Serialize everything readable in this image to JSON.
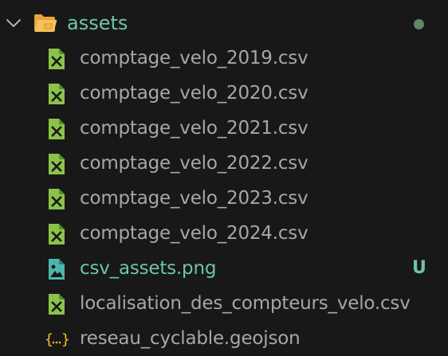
{
  "explorer": {
    "folder": {
      "name": "assets",
      "expanded": true,
      "chevron_icon": "chevron-down-icon",
      "icon": "folder-open-icon",
      "status_dot_color": "#5b8a64"
    },
    "files": [
      {
        "name": "comptage_velo_2019.csv",
        "icon": "csv-file-icon",
        "badge": ""
      },
      {
        "name": "comptage_velo_2020.csv",
        "icon": "csv-file-icon",
        "badge": ""
      },
      {
        "name": "comptage_velo_2021.csv",
        "icon": "csv-file-icon",
        "badge": ""
      },
      {
        "name": "comptage_velo_2022.csv",
        "icon": "csv-file-icon",
        "badge": ""
      },
      {
        "name": "comptage_velo_2023.csv",
        "icon": "csv-file-icon",
        "badge": ""
      },
      {
        "name": "comptage_velo_2024.csv",
        "icon": "csv-file-icon",
        "badge": ""
      },
      {
        "name": "csv_assets.png",
        "icon": "image-file-icon",
        "badge": "U"
      },
      {
        "name": "localisation_des_compteurs_velo.csv",
        "icon": "csv-file-icon",
        "badge": ""
      },
      {
        "name": "reseau_cyclable.geojson",
        "icon": "json-file-icon",
        "badge": ""
      }
    ]
  },
  "colors": {
    "background": "#181818",
    "file_text": "#a7a7a7",
    "untracked_text": "#6ec5a9",
    "csv_icon": "#8bc34a",
    "image_icon": "#4db6ac",
    "json_icon": "#fbc02d",
    "folder_icon": "#e8a33d"
  }
}
